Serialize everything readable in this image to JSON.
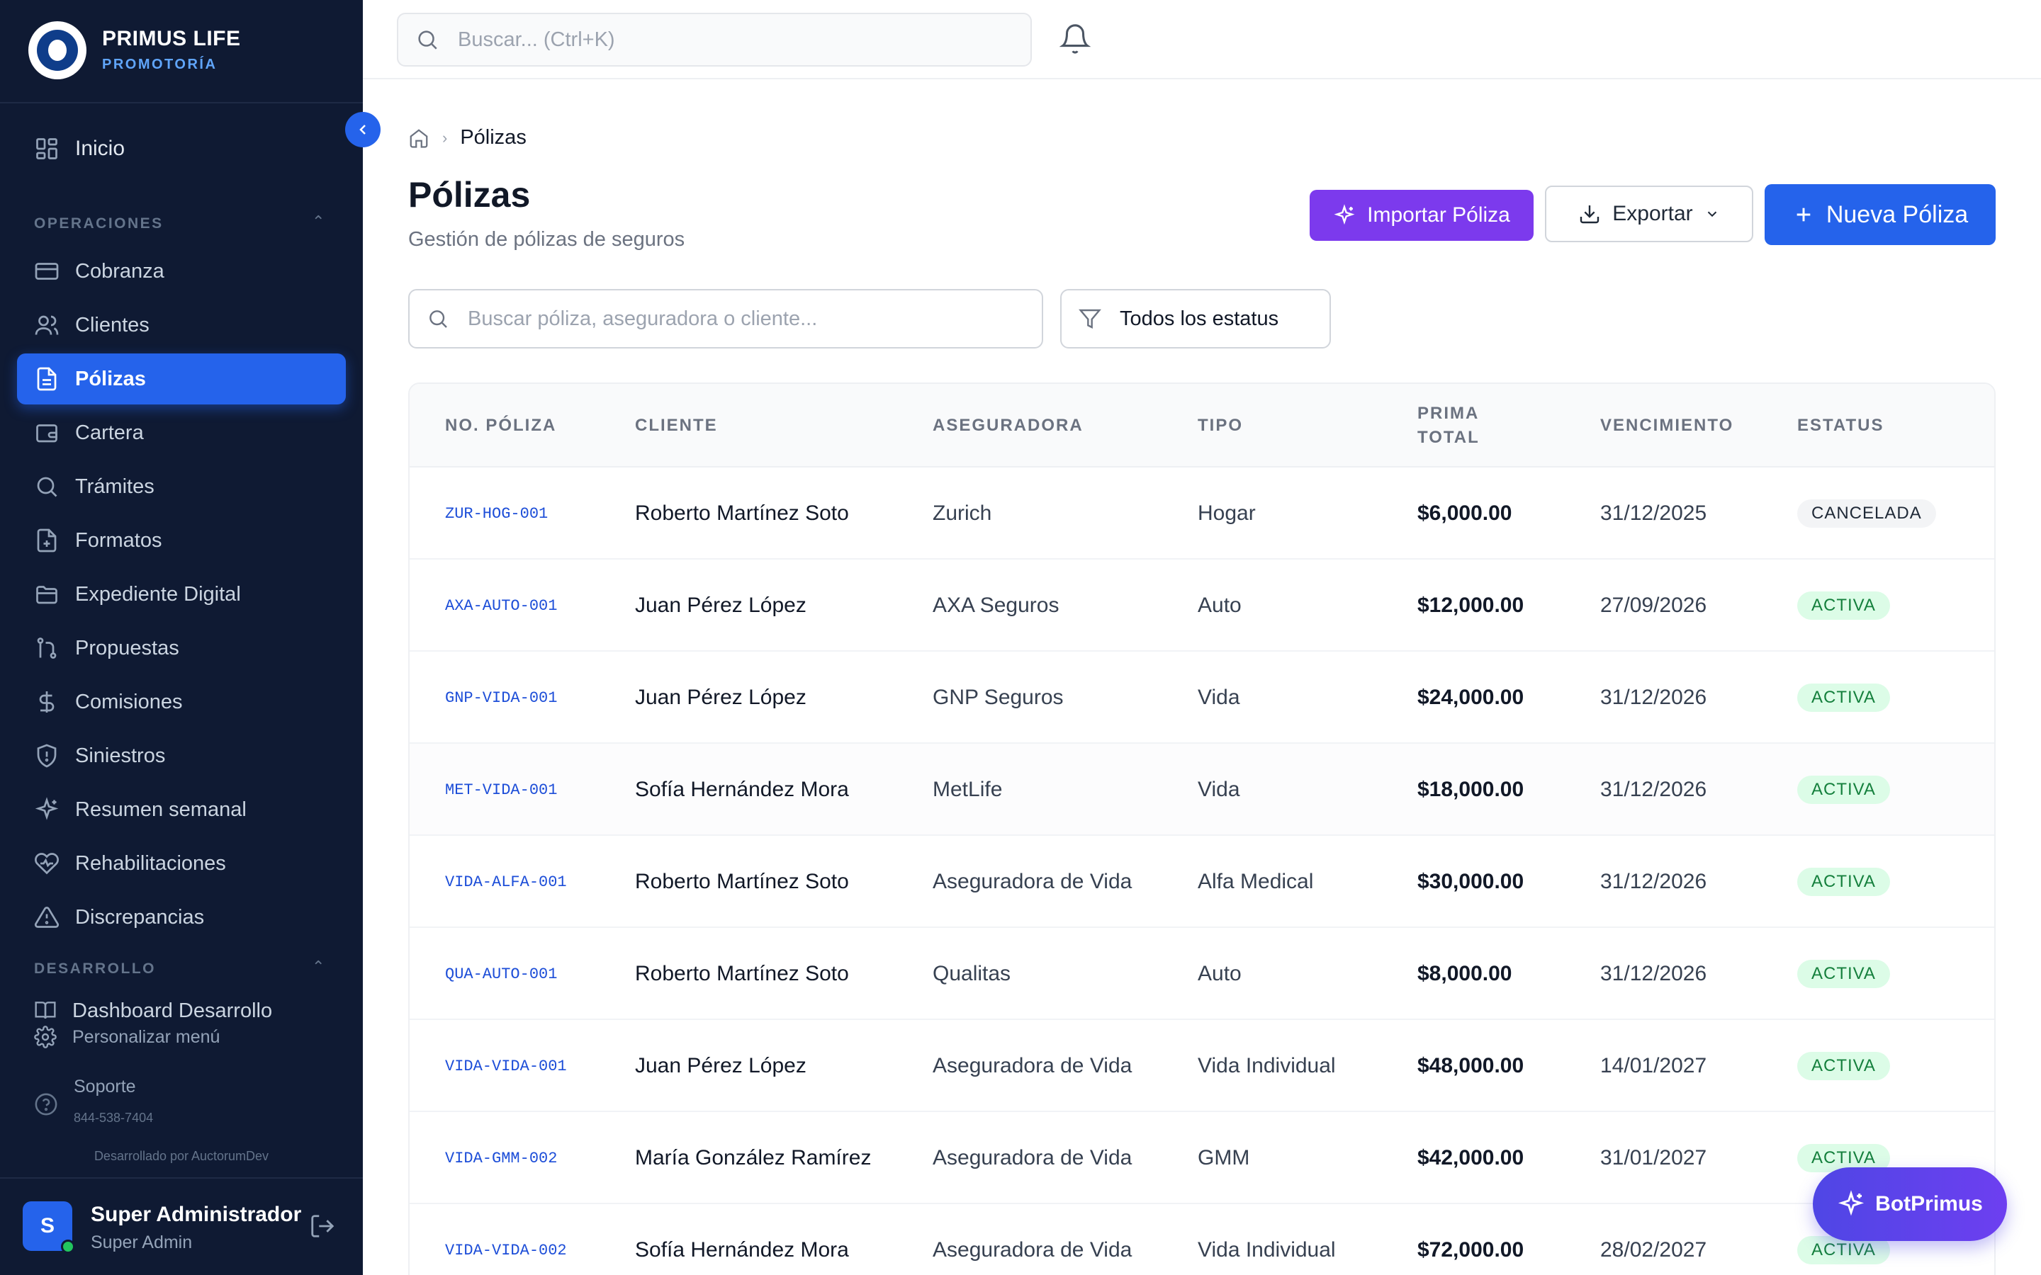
{
  "brand": {
    "name": "PRIMUS LIFE",
    "subtitle": "PROMOTORÍA"
  },
  "sidebar": {
    "home": {
      "label": "Inicio",
      "icon": "grid-icon"
    },
    "sections": [
      {
        "label": "OPERACIONES"
      },
      {
        "label": "DESARROLLO"
      }
    ],
    "items": [
      {
        "label": "Cobranza",
        "icon": "credit-card-icon"
      },
      {
        "label": "Clientes",
        "icon": "users-icon"
      },
      {
        "label": "Pólizas",
        "icon": "document-icon",
        "active": true
      },
      {
        "label": "Cartera",
        "icon": "wallet-icon"
      },
      {
        "label": "Trámites",
        "icon": "search-icon"
      },
      {
        "label": "Formatos",
        "icon": "file-plus-icon"
      },
      {
        "label": "Expediente Digital",
        "icon": "folder-icon"
      },
      {
        "label": "Propuestas",
        "icon": "git-branch-icon"
      },
      {
        "label": "Comisiones",
        "icon": "dollar-icon"
      },
      {
        "label": "Siniestros",
        "icon": "shield-icon"
      },
      {
        "label": "Resumen semanal",
        "icon": "sparkle-icon"
      },
      {
        "label": "Rehabilitaciones",
        "icon": "heart-icon"
      },
      {
        "label": "Discrepancias",
        "icon": "warning-icon"
      }
    ],
    "dev_item": "Dashboard Desarrollo",
    "personalize": "Personalizar menú",
    "support": {
      "label": "Soporte",
      "phone": "844-538-7404"
    },
    "developed_by": "Desarrollado por AuctorumDev",
    "user": {
      "initial": "S",
      "name": "Super Administrador",
      "role": "Super Admin"
    }
  },
  "topbar": {
    "search_placeholder": "Buscar... (Ctrl+K)"
  },
  "breadcrumb": {
    "current": "Pólizas"
  },
  "page": {
    "title": "Pólizas",
    "subtitle": "Gestión de pólizas de seguros"
  },
  "actions": {
    "import": "Importar Póliza",
    "export": "Exportar",
    "new": "Nueva Póliza"
  },
  "filters": {
    "search_placeholder": "Buscar póliza, aseguradora o cliente...",
    "status": "Todos los estatus"
  },
  "table": {
    "headers": [
      "NO. PÓLIZA",
      "CLIENTE",
      "ASEGURADORA",
      "TIPO",
      "PRIMA TOTAL",
      "VENCIMIENTO",
      "ESTATUS"
    ],
    "rows": [
      {
        "poliza": "ZUR-HOG-001",
        "cliente": "Roberto Martínez Soto",
        "aseguradora": "Zurich",
        "tipo": "Hogar",
        "prima": "$6,000.00",
        "vencimiento": "31/12/2025",
        "estatus": "CANCELADA"
      },
      {
        "poliza": "AXA-AUTO-001",
        "cliente": "Juan Pérez López",
        "aseguradora": "AXA Seguros",
        "tipo": "Auto",
        "prima": "$12,000.00",
        "vencimiento": "27/09/2026",
        "estatus": "ACTIVA"
      },
      {
        "poliza": "GNP-VIDA-001",
        "cliente": "Juan Pérez López",
        "aseguradora": "GNP Seguros",
        "tipo": "Vida",
        "prima": "$24,000.00",
        "vencimiento": "31/12/2026",
        "estatus": "ACTIVA"
      },
      {
        "poliza": "MET-VIDA-001",
        "cliente": "Sofía Hernández Mora",
        "aseguradora": "MetLife",
        "tipo": "Vida",
        "prima": "$18,000.00",
        "vencimiento": "31/12/2026",
        "estatus": "ACTIVA"
      },
      {
        "poliza": "VIDA-ALFA-001",
        "cliente": "Roberto Martínez Soto",
        "aseguradora": "Aseguradora de Vida",
        "tipo": "Alfa Medical",
        "prima": "$30,000.00",
        "vencimiento": "31/12/2026",
        "estatus": "ACTIVA"
      },
      {
        "poliza": "QUA-AUTO-001",
        "cliente": "Roberto Martínez Soto",
        "aseguradora": "Qualitas",
        "tipo": "Auto",
        "prima": "$8,000.00",
        "vencimiento": "31/12/2026",
        "estatus": "ACTIVA"
      },
      {
        "poliza": "VIDA-VIDA-001",
        "cliente": "Juan Pérez López",
        "aseguradora": "Aseguradora de Vida",
        "tipo": "Vida Individual",
        "prima": "$48,000.00",
        "vencimiento": "14/01/2027",
        "estatus": "ACTIVA"
      },
      {
        "poliza": "VIDA-GMM-002",
        "cliente": "María González Ramírez",
        "aseguradora": "Aseguradora de Vida",
        "tipo": "GMM",
        "prima": "$42,000.00",
        "vencimiento": "31/01/2027",
        "estatus": "ACTIVA"
      },
      {
        "poliza": "VIDA-VIDA-002",
        "cliente": "Sofía Hernández Mora",
        "aseguradora": "Aseguradora de Vida",
        "tipo": "Vida Individual",
        "prima": "$72,000.00",
        "vencimiento": "28/02/2027",
        "estatus": "ACTIVA"
      }
    ]
  },
  "bot": {
    "label": "BotPrimus"
  },
  "colors": {
    "sidebar_bg": "#0f1a33",
    "primary": "#2563eb",
    "import": "#7c3aed",
    "active_badge": "#dcfce7"
  }
}
